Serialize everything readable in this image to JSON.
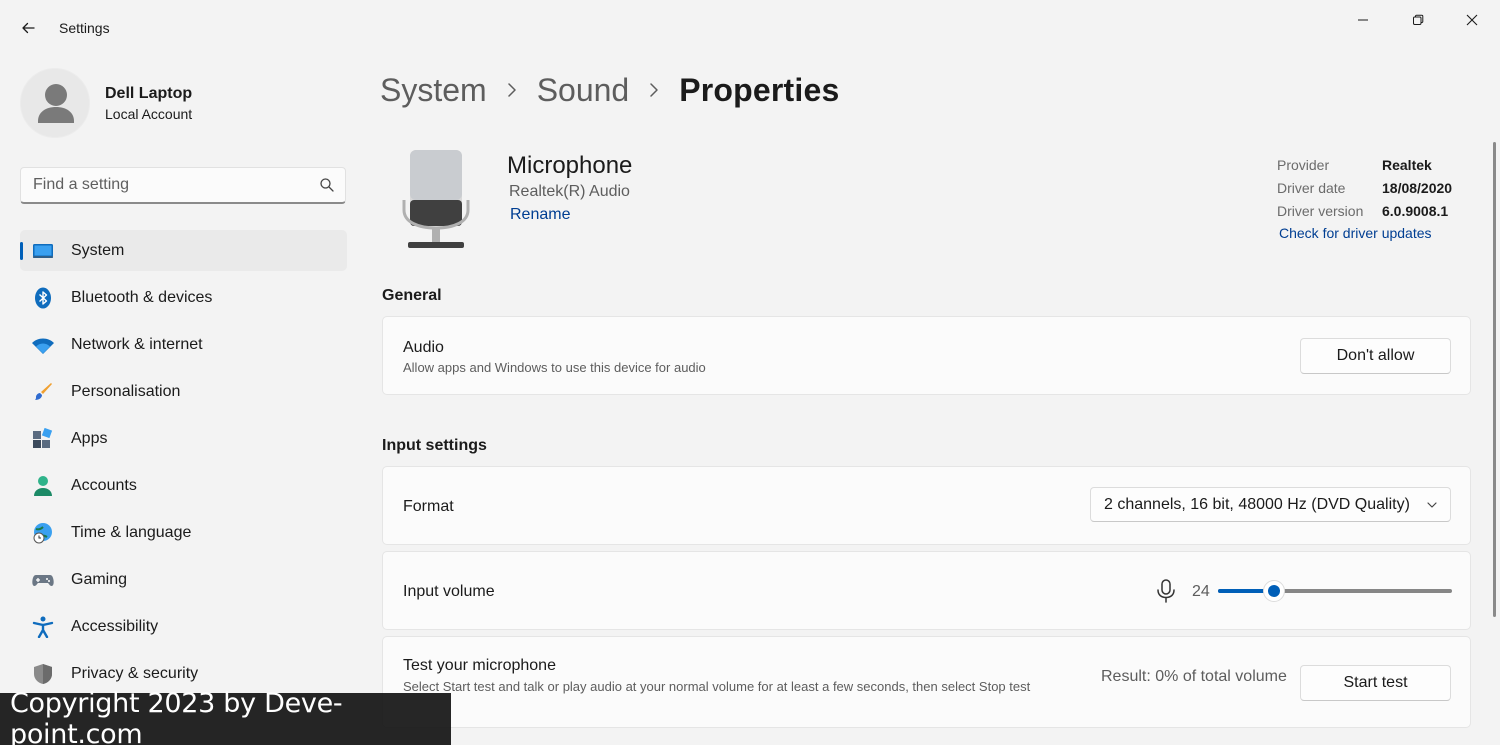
{
  "window": {
    "title": "Settings"
  },
  "profile": {
    "name": "Dell Laptop",
    "account_type": "Local Account"
  },
  "search": {
    "placeholder": "Find a setting"
  },
  "sidebar": {
    "items": [
      {
        "label": "System",
        "icon": "system-icon",
        "active": true
      },
      {
        "label": "Bluetooth & devices",
        "icon": "bluetooth-icon"
      },
      {
        "label": "Network & internet",
        "icon": "wifi-icon"
      },
      {
        "label": "Personalisation",
        "icon": "brush-icon"
      },
      {
        "label": "Apps",
        "icon": "apps-icon"
      },
      {
        "label": "Accounts",
        "icon": "accounts-icon"
      },
      {
        "label": "Time & language",
        "icon": "globe-clock-icon"
      },
      {
        "label": "Gaming",
        "icon": "gamepad-icon"
      },
      {
        "label": "Accessibility",
        "icon": "accessibility-icon"
      },
      {
        "label": "Privacy & security",
        "icon": "shield-icon"
      }
    ]
  },
  "breadcrumb": [
    "System",
    "Sound",
    "Properties"
  ],
  "device": {
    "name": "Microphone",
    "driver_name": "Realtek(R) Audio",
    "rename_label": "Rename"
  },
  "driver": {
    "rows": [
      {
        "key": "Provider",
        "value": "Realtek"
      },
      {
        "key": "Driver date",
        "value": "18/08/2020"
      },
      {
        "key": "Driver version",
        "value": "6.0.9008.1"
      }
    ],
    "update_link": "Check for driver updates"
  },
  "general": {
    "section_title": "General",
    "audio": {
      "title": "Audio",
      "description": "Allow apps and Windows to use this device for audio",
      "button_label": "Don't allow"
    }
  },
  "input_settings": {
    "section_title": "Input settings",
    "format": {
      "label": "Format",
      "selected": "2 channels, 16 bit, 48000 Hz (DVD Quality)"
    },
    "volume": {
      "label": "Input volume",
      "value": "24",
      "percent": 24
    },
    "test": {
      "title": "Test your microphone",
      "description": "Select Start test and talk or play audio at your normal volume for at least a few seconds, then select Stop test",
      "result": "Result: 0% of total volume",
      "button_label": "Start test"
    }
  },
  "watermark": "Copyright 2023 by Deve-point.com",
  "colors": {
    "accent": "#005fb8",
    "link": "#003e92",
    "background": "#f3f3f3",
    "card": "#fbfbfb"
  }
}
